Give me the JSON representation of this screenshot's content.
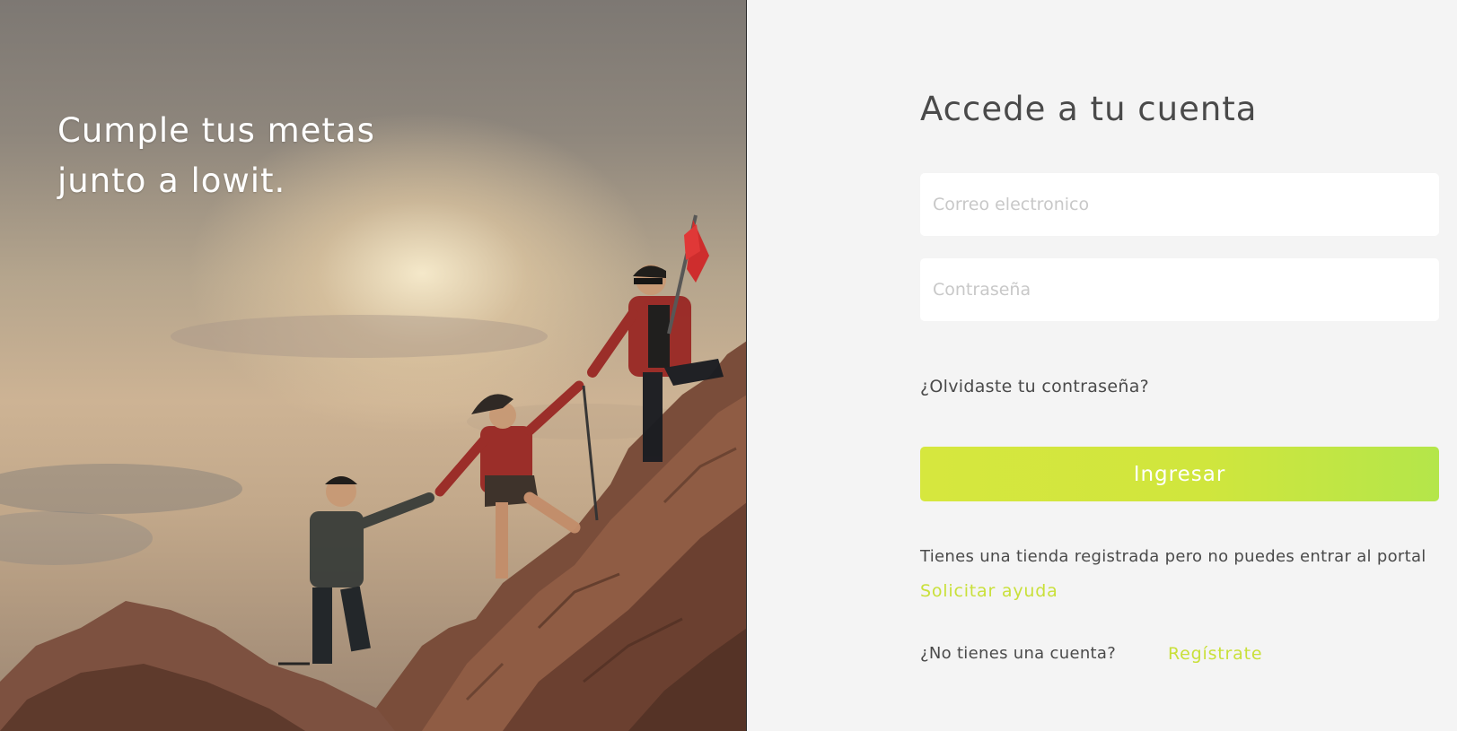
{
  "hero": {
    "headline_line1": "Cumple tus metas",
    "headline_line2": "junto a lowit.",
    "image": "mountain-climbers-photo"
  },
  "login": {
    "title": "Accede a tu cuenta",
    "email_placeholder": "Correo electronico",
    "email_value": "",
    "password_placeholder": "Contraseña",
    "password_value": "",
    "forgot_password": "¿Olvidaste tu contraseña?",
    "submit_label": "Ingresar",
    "store_help_text": "Tienes una tienda registrada pero no puedes entrar al portal",
    "store_help_link": "Solicitar ayuda",
    "no_account_text": "¿No tienes una cuenta?",
    "register_link": "Regístrate"
  },
  "colors": {
    "accent": "#c9e03a",
    "button_gradient_start": "#d6e73e",
    "button_gradient_end": "#b4e64a",
    "text": "#4a4a4a",
    "background": "#f4f4f4"
  }
}
